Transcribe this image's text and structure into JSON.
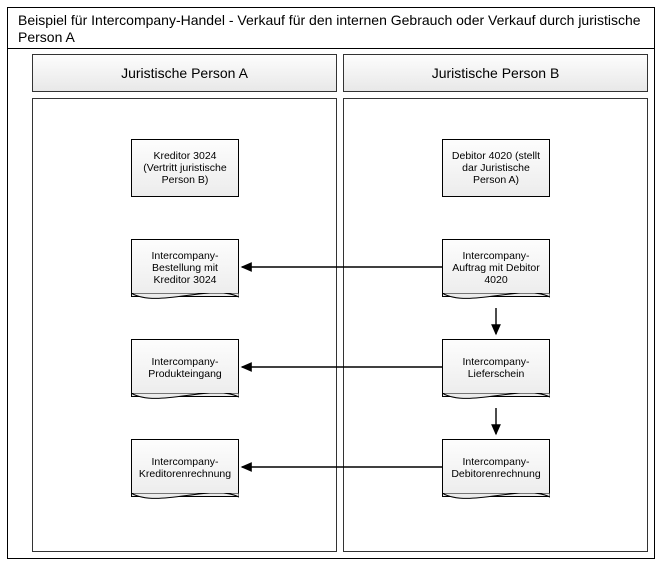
{
  "title": "Beispiel für Intercompany-Handel - Verkauf für den internen Gebrauch oder Verkauf durch juristische Person A",
  "columns": {
    "a": "Juristische Person A",
    "b": "Juristische Person B"
  },
  "nodes": {
    "a_kreditor": "Kreditor 3024 (Vertritt juristische Person B)",
    "a_bestell": "Intercompany-Bestellung mit Kreditor 3024",
    "a_eingang": "Intercompany-Produkteingang",
    "a_kredrech": "Intercompany-Kreditorenrechnung",
    "b_debitor": "Debitor 4020 (stellt dar Juristische Person A)",
    "b_auftrag": "Intercompany-Auftrag mit Debitor 4020",
    "b_liefer": "Intercompany-Lieferschein",
    "b_debrech": "Intercompany-Debitorenrechnung"
  },
  "chart_data": {
    "type": "flow-diagram",
    "swimlanes": [
      "Juristische Person A",
      "Juristische Person B"
    ],
    "nodes": [
      {
        "id": "a_kreditor",
        "lane": 0,
        "row": 0,
        "shape": "box",
        "label": "Kreditor 3024 (Vertritt juristische Person B)"
      },
      {
        "id": "b_debitor",
        "lane": 1,
        "row": 0,
        "shape": "box",
        "label": "Debitor 4020 (stellt dar Juristische Person A)"
      },
      {
        "id": "a_bestell",
        "lane": 0,
        "row": 1,
        "shape": "document",
        "label": "Intercompany-Bestellung mit Kreditor 3024"
      },
      {
        "id": "b_auftrag",
        "lane": 1,
        "row": 1,
        "shape": "document",
        "label": "Intercompany-Auftrag mit Debitor 4020"
      },
      {
        "id": "a_eingang",
        "lane": 0,
        "row": 2,
        "shape": "document",
        "label": "Intercompany-Produkteingang"
      },
      {
        "id": "b_liefer",
        "lane": 1,
        "row": 2,
        "shape": "document",
        "label": "Intercompany-Lieferschein"
      },
      {
        "id": "a_kredrech",
        "lane": 0,
        "row": 3,
        "shape": "document",
        "label": "Intercompany-Kreditorenrechnung"
      },
      {
        "id": "b_debrech",
        "lane": 1,
        "row": 3,
        "shape": "document",
        "label": "Intercompany-Debitorenrechnung"
      }
    ],
    "edges": [
      {
        "from": "b_auftrag",
        "to": "a_bestell"
      },
      {
        "from": "b_auftrag",
        "to": "b_liefer"
      },
      {
        "from": "b_liefer",
        "to": "a_eingang"
      },
      {
        "from": "b_liefer",
        "to": "b_debrech"
      },
      {
        "from": "b_debrech",
        "to": "a_kredrech"
      }
    ]
  }
}
